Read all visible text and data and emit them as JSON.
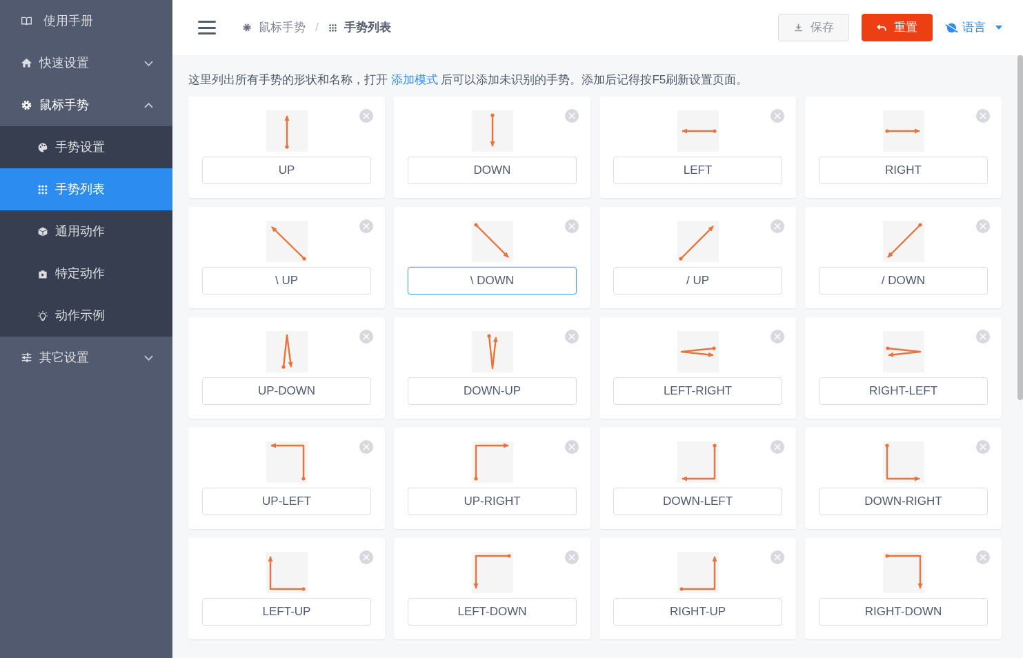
{
  "sidebar": {
    "items": [
      {
        "kind": "link",
        "label": "使用手册",
        "selected": false
      },
      {
        "kind": "group",
        "label": "快速设置",
        "selected": false,
        "expanded": false
      },
      {
        "kind": "group",
        "label": "鼠标手势",
        "selected": false,
        "expanded": true,
        "children": [
          {
            "label": "手势设置",
            "selected": false
          },
          {
            "label": "手势列表",
            "selected": true
          },
          {
            "label": "通用动作",
            "selected": false
          },
          {
            "label": "特定动作",
            "selected": false
          },
          {
            "label": "动作示例",
            "selected": false
          }
        ]
      },
      {
        "kind": "group",
        "label": "其它设置",
        "selected": false,
        "expanded": false
      }
    ]
  },
  "header": {
    "breadcrumb": [
      {
        "label": "鼠标手势",
        "current": false
      },
      {
        "label": "手势列表",
        "current": true
      }
    ],
    "breadcrumb_separator": "/",
    "buttons": [
      {
        "kind": "save",
        "label": "保存",
        "disabled": true
      },
      {
        "kind": "reset",
        "label": "重置",
        "disabled": false
      }
    ],
    "language": {
      "label": "语言"
    }
  },
  "info": {
    "before": "这里列出所有手势的形状和名称，打开 ",
    "link": "添加模式",
    "after": " 后可以添加未识别的手势。添加后记得按F5刷新设置页面。"
  },
  "gestures": [
    {
      "kind": "up",
      "name": "UP",
      "focused": false
    },
    {
      "kind": "down",
      "name": "DOWN",
      "focused": false
    },
    {
      "kind": "left",
      "name": "LEFT",
      "focused": false
    },
    {
      "kind": "right",
      "name": "RIGHT",
      "focused": false
    },
    {
      "kind": "backslashup",
      "name": "\\ UP",
      "focused": false
    },
    {
      "kind": "backslashdown",
      "name": "\\ DOWN",
      "focused": true
    },
    {
      "kind": "slashup",
      "name": "/ UP",
      "focused": false
    },
    {
      "kind": "slashdown",
      "name": "/ DOWN",
      "focused": false
    },
    {
      "kind": "updown",
      "name": "UP-DOWN",
      "focused": false
    },
    {
      "kind": "downup",
      "name": "DOWN-UP",
      "focused": false
    },
    {
      "kind": "leftright",
      "name": "LEFT-RIGHT",
      "focused": false
    },
    {
      "kind": "rightleft",
      "name": "RIGHT-LEFT",
      "focused": false
    },
    {
      "kind": "upleft",
      "name": "UP-LEFT",
      "focused": false
    },
    {
      "kind": "upright",
      "name": "UP-RIGHT",
      "focused": false
    },
    {
      "kind": "downleft",
      "name": "DOWN-LEFT",
      "focused": false
    },
    {
      "kind": "downright",
      "name": "DOWN-RIGHT",
      "focused": false
    },
    {
      "kind": "leftup",
      "name": "LEFT-UP",
      "focused": false
    },
    {
      "kind": "leftdown",
      "name": "LEFT-DOWN",
      "focused": false
    },
    {
      "kind": "rightup",
      "name": "RIGHT-UP",
      "focused": false
    },
    {
      "kind": "rightdown",
      "name": "RIGHT-DOWN",
      "focused": false
    }
  ]
}
